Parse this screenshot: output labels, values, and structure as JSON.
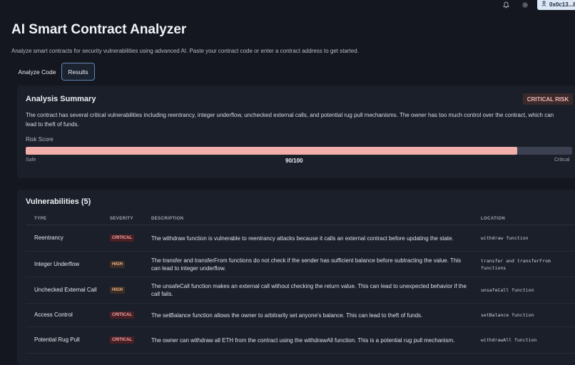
{
  "header": {
    "wallet_label": "0x0c13...8",
    "bell_icon": "bell-icon",
    "settings_icon": "gear-icon",
    "user_icon": "user-icon"
  },
  "page": {
    "title": "AI Smart Contract Analyzer",
    "subtitle": "Analyze smart contracts for security vulnerabilities using advanced AI. Paste your contract code or enter a contract address to get started."
  },
  "tabs": [
    {
      "label": "Analyze Code",
      "active": false
    },
    {
      "label": "Results",
      "active": true
    }
  ],
  "summary": {
    "title": "Analysis Summary",
    "risk_badge": "CRITICAL RISK",
    "text": "The contract has several critical vulnerabilities including reentrancy, integer underflow, unchecked external calls, and potential rug pull mechanisms. The owner has too much control over the contract, which can lead to theft of funds.",
    "risk_label": "Risk Score",
    "score_text": "90/100",
    "score_fraction": 0.9,
    "scale_min_label": "Safe",
    "scale_max_label": "Critical",
    "colors": {
      "bar_fill": "#f1aeaa",
      "bar_track": "#3b4150",
      "badge_bg": "#3a2a2c"
    }
  },
  "vulnerabilities": {
    "title": "Vulnerabilities (5)",
    "columns": [
      "TYPE",
      "SEVERITY",
      "DESCRIPTION",
      "LOCATION"
    ],
    "rows": [
      {
        "type": "Reentrancy",
        "severity": "CRITICAL",
        "description": "The withdraw function is vulnerable to reentrancy attacks because it calls an external contract before updating the state.",
        "location": "withdraw function"
      },
      {
        "type": "Integer Underflow",
        "severity": "HIGH",
        "description": "The transfer and transferFrom functions do not check if the sender has sufficient balance before subtracting the value. This can lead to integer underflow.",
        "location": "transfer and transferFrom functions"
      },
      {
        "type": "Unchecked External Call",
        "severity": "HIGH",
        "description": "The unsafeCall function makes an external call without checking the return value. This can lead to unexpected behavior if the call fails.",
        "location": "unsafeCall function"
      },
      {
        "type": "Access Control",
        "severity": "CRITICAL",
        "description": "The setBalance function allows the owner to arbitrarily set anyone's balance. This can lead to theft of funds.",
        "location": "setBalance function"
      },
      {
        "type": "Potential Rug Pull",
        "severity": "CRITICAL",
        "description": "The owner can withdraw all ETH from the contract using the withdrawAll function. This is a potential rug pull mechanism.",
        "location": "withdrawAll function"
      }
    ]
  }
}
